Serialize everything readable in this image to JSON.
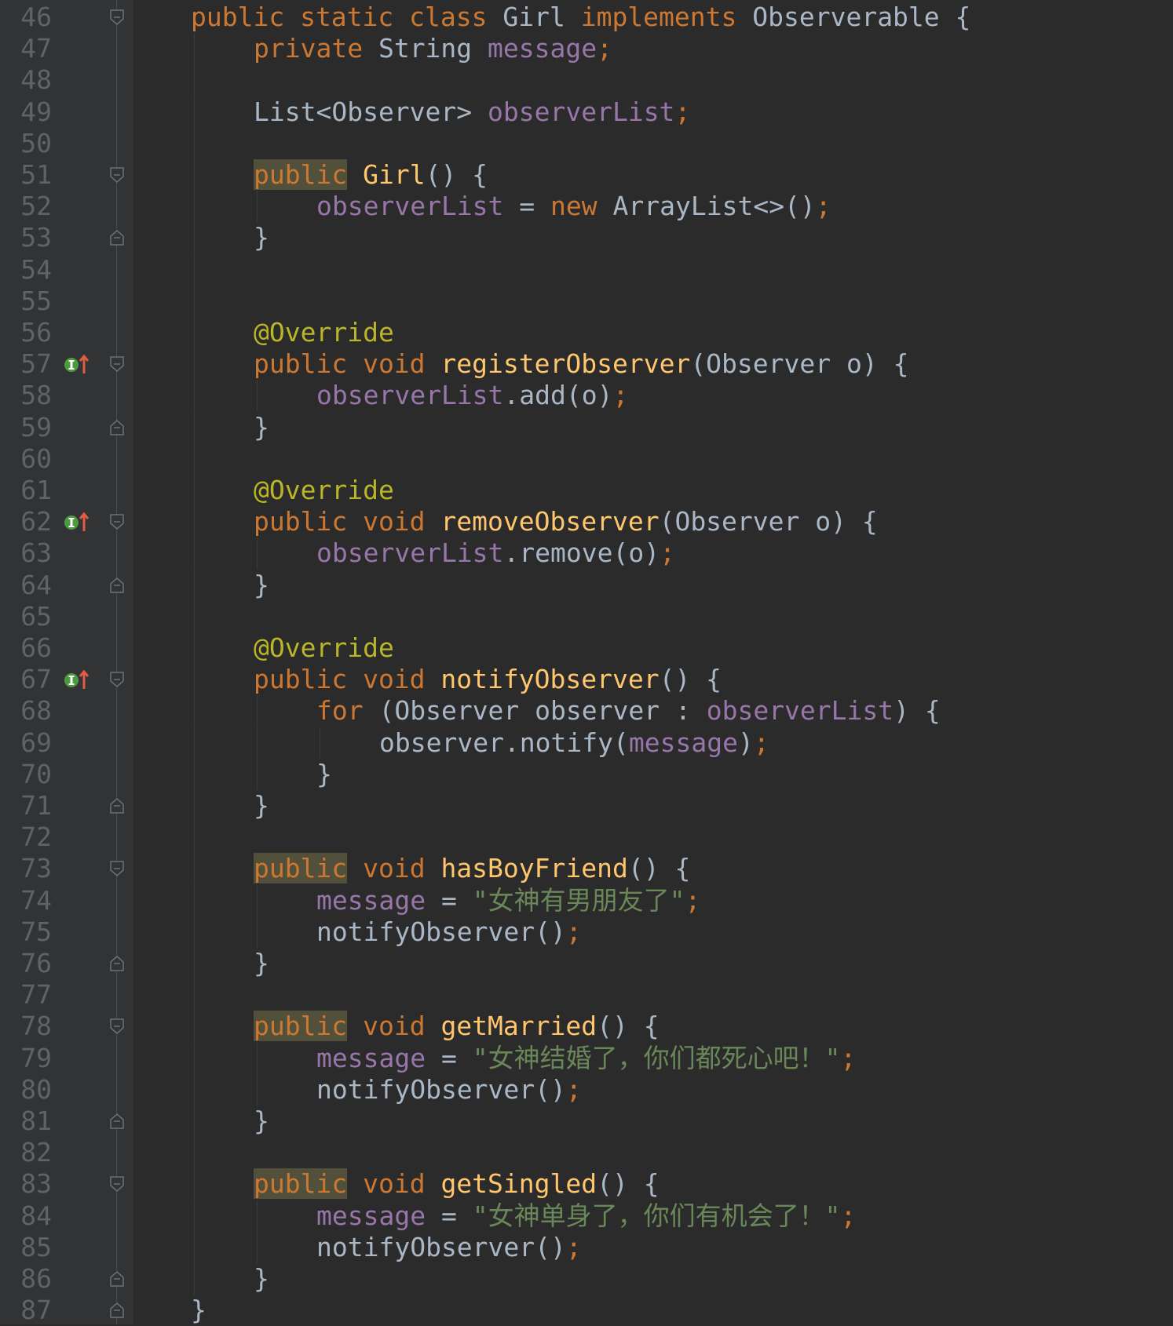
{
  "editor": {
    "colors": {
      "background": "#2b2b2b",
      "gutter": "#313335",
      "line_number": "#606366",
      "keyword": "#cc7832",
      "default": "#a9b7c6",
      "field": "#9876aa",
      "method": "#ffc66d",
      "annotation": "#bbb529",
      "string": "#6a8759",
      "highlight": "#52503a"
    },
    "icons": {
      "implements_marker": "implements-method-icon",
      "fold": "fold-marker-icon"
    },
    "lines": [
      {
        "n": "46",
        "fold": "open",
        "mark": false,
        "indent": 1,
        "tokens": [
          [
            "kw",
            "public static class "
          ],
          [
            "cls",
            "Girl "
          ],
          [
            "kw",
            "implements "
          ],
          [
            "cls",
            "Observerable {"
          ]
        ]
      },
      {
        "n": "47",
        "fold": "",
        "mark": false,
        "indent": 2,
        "tokens": [
          [
            "kw",
            "private "
          ],
          [
            "cls",
            "String "
          ],
          [
            "fld",
            "message"
          ],
          [
            "punc",
            ";"
          ]
        ]
      },
      {
        "n": "48",
        "fold": "",
        "mark": false,
        "indent": 2,
        "tokens": []
      },
      {
        "n": "49",
        "fold": "",
        "mark": false,
        "indent": 2,
        "tokens": [
          [
            "cls",
            "List<Observer> "
          ],
          [
            "fld",
            "observerList"
          ],
          [
            "punc",
            ";"
          ]
        ]
      },
      {
        "n": "50",
        "fold": "",
        "mark": false,
        "indent": 2,
        "tokens": []
      },
      {
        "n": "51",
        "fold": "open",
        "mark": false,
        "indent": 2,
        "tokens": [
          [
            "kw hl",
            "public"
          ],
          [
            "cls",
            " "
          ],
          [
            "fn",
            "Girl"
          ],
          [
            "cls",
            "() {"
          ]
        ]
      },
      {
        "n": "52",
        "fold": "",
        "mark": false,
        "indent": 3,
        "tokens": [
          [
            "fld",
            "observerList "
          ],
          [
            "cls",
            "= "
          ],
          [
            "kw",
            "new "
          ],
          [
            "cls",
            "ArrayList<>()"
          ],
          [
            "punc",
            ";"
          ]
        ]
      },
      {
        "n": "53",
        "fold": "close",
        "mark": false,
        "indent": 2,
        "tokens": [
          [
            "cls",
            "}"
          ]
        ]
      },
      {
        "n": "54",
        "fold": "",
        "mark": false,
        "indent": 2,
        "tokens": []
      },
      {
        "n": "55",
        "fold": "",
        "mark": false,
        "indent": 2,
        "tokens": []
      },
      {
        "n": "56",
        "fold": "",
        "mark": false,
        "indent": 2,
        "tokens": [
          [
            "ann",
            "@Override"
          ]
        ]
      },
      {
        "n": "57",
        "fold": "open",
        "mark": true,
        "indent": 2,
        "tokens": [
          [
            "kw",
            "public void "
          ],
          [
            "fn",
            "registerObserver"
          ],
          [
            "cls",
            "(Observer o) {"
          ]
        ]
      },
      {
        "n": "58",
        "fold": "",
        "mark": false,
        "indent": 3,
        "tokens": [
          [
            "fld",
            "observerList"
          ],
          [
            "cls",
            ".add(o)"
          ],
          [
            "punc",
            ";"
          ]
        ]
      },
      {
        "n": "59",
        "fold": "close",
        "mark": false,
        "indent": 2,
        "tokens": [
          [
            "cls",
            "}"
          ]
        ]
      },
      {
        "n": "60",
        "fold": "",
        "mark": false,
        "indent": 2,
        "tokens": []
      },
      {
        "n": "61",
        "fold": "",
        "mark": false,
        "indent": 2,
        "tokens": [
          [
            "ann",
            "@Override"
          ]
        ]
      },
      {
        "n": "62",
        "fold": "open",
        "mark": true,
        "indent": 2,
        "tokens": [
          [
            "kw",
            "public void "
          ],
          [
            "fn",
            "removeObserver"
          ],
          [
            "cls",
            "(Observer o) {"
          ]
        ]
      },
      {
        "n": "63",
        "fold": "",
        "mark": false,
        "indent": 3,
        "tokens": [
          [
            "fld",
            "observerList"
          ],
          [
            "cls",
            ".remove(o)"
          ],
          [
            "punc",
            ";"
          ]
        ]
      },
      {
        "n": "64",
        "fold": "close",
        "mark": false,
        "indent": 2,
        "tokens": [
          [
            "cls",
            "}"
          ]
        ]
      },
      {
        "n": "65",
        "fold": "",
        "mark": false,
        "indent": 2,
        "tokens": []
      },
      {
        "n": "66",
        "fold": "",
        "mark": false,
        "indent": 2,
        "tokens": [
          [
            "ann",
            "@Override"
          ]
        ]
      },
      {
        "n": "67",
        "fold": "open",
        "mark": true,
        "indent": 2,
        "tokens": [
          [
            "kw",
            "public void "
          ],
          [
            "fn",
            "notifyObserver"
          ],
          [
            "cls",
            "() {"
          ]
        ]
      },
      {
        "n": "68",
        "fold": "",
        "mark": false,
        "indent": 3,
        "tokens": [
          [
            "kw",
            "for "
          ],
          [
            "cls",
            "(Observer observer : "
          ],
          [
            "fld",
            "observerList"
          ],
          [
            "cls",
            ") {"
          ]
        ]
      },
      {
        "n": "69",
        "fold": "",
        "mark": false,
        "indent": 4,
        "tokens": [
          [
            "cls",
            "observer.notify("
          ],
          [
            "fld",
            "message"
          ],
          [
            "cls",
            ")"
          ],
          [
            "punc",
            ";"
          ]
        ]
      },
      {
        "n": "70",
        "fold": "",
        "mark": false,
        "indent": 3,
        "tokens": [
          [
            "cls",
            "}"
          ]
        ]
      },
      {
        "n": "71",
        "fold": "close",
        "mark": false,
        "indent": 2,
        "tokens": [
          [
            "cls",
            "}"
          ]
        ]
      },
      {
        "n": "72",
        "fold": "",
        "mark": false,
        "indent": 2,
        "tokens": []
      },
      {
        "n": "73",
        "fold": "open",
        "mark": false,
        "indent": 2,
        "tokens": [
          [
            "kw hl",
            "public"
          ],
          [
            "kw",
            " void "
          ],
          [
            "fn",
            "hasBoyFriend"
          ],
          [
            "cls",
            "() {"
          ]
        ]
      },
      {
        "n": "74",
        "fold": "",
        "mark": false,
        "indent": 3,
        "tokens": [
          [
            "fld",
            "message "
          ],
          [
            "cls",
            "= "
          ],
          [
            "str",
            "\"女神有男朋友了\""
          ],
          [
            "punc",
            ";"
          ]
        ]
      },
      {
        "n": "75",
        "fold": "",
        "mark": false,
        "indent": 3,
        "tokens": [
          [
            "cls",
            "notifyObserver()"
          ],
          [
            "punc",
            ";"
          ]
        ]
      },
      {
        "n": "76",
        "fold": "close",
        "mark": false,
        "indent": 2,
        "tokens": [
          [
            "cls",
            "}"
          ]
        ]
      },
      {
        "n": "77",
        "fold": "",
        "mark": false,
        "indent": 2,
        "tokens": []
      },
      {
        "n": "78",
        "fold": "open",
        "mark": false,
        "indent": 2,
        "tokens": [
          [
            "kw hl",
            "public"
          ],
          [
            "kw",
            " void "
          ],
          [
            "fn",
            "getMarried"
          ],
          [
            "cls",
            "() {"
          ]
        ]
      },
      {
        "n": "79",
        "fold": "",
        "mark": false,
        "indent": 3,
        "tokens": [
          [
            "fld",
            "message "
          ],
          [
            "cls",
            "= "
          ],
          [
            "str",
            "\"女神结婚了，你们都死心吧！\""
          ],
          [
            "punc",
            ";"
          ]
        ]
      },
      {
        "n": "80",
        "fold": "",
        "mark": false,
        "indent": 3,
        "tokens": [
          [
            "cls",
            "notifyObserver()"
          ],
          [
            "punc",
            ";"
          ]
        ]
      },
      {
        "n": "81",
        "fold": "close",
        "mark": false,
        "indent": 2,
        "tokens": [
          [
            "cls",
            "}"
          ]
        ]
      },
      {
        "n": "82",
        "fold": "",
        "mark": false,
        "indent": 2,
        "tokens": []
      },
      {
        "n": "83",
        "fold": "open",
        "mark": false,
        "indent": 2,
        "tokens": [
          [
            "kw hl",
            "public"
          ],
          [
            "kw",
            " void "
          ],
          [
            "fn",
            "getSingled"
          ],
          [
            "cls",
            "() {"
          ]
        ]
      },
      {
        "n": "84",
        "fold": "",
        "mark": false,
        "indent": 3,
        "tokens": [
          [
            "fld",
            "message "
          ],
          [
            "cls",
            "= "
          ],
          [
            "str",
            "\"女神单身了，你们有机会了！\""
          ],
          [
            "punc",
            ";"
          ]
        ]
      },
      {
        "n": "85",
        "fold": "",
        "mark": false,
        "indent": 3,
        "tokens": [
          [
            "cls",
            "notifyObserver()"
          ],
          [
            "punc",
            ";"
          ]
        ]
      },
      {
        "n": "86",
        "fold": "close",
        "mark": false,
        "indent": 2,
        "tokens": [
          [
            "cls",
            "}"
          ]
        ]
      },
      {
        "n": "87",
        "fold": "close",
        "mark": false,
        "indent": 1,
        "tokens": [
          [
            "cls",
            "}"
          ]
        ]
      }
    ]
  }
}
